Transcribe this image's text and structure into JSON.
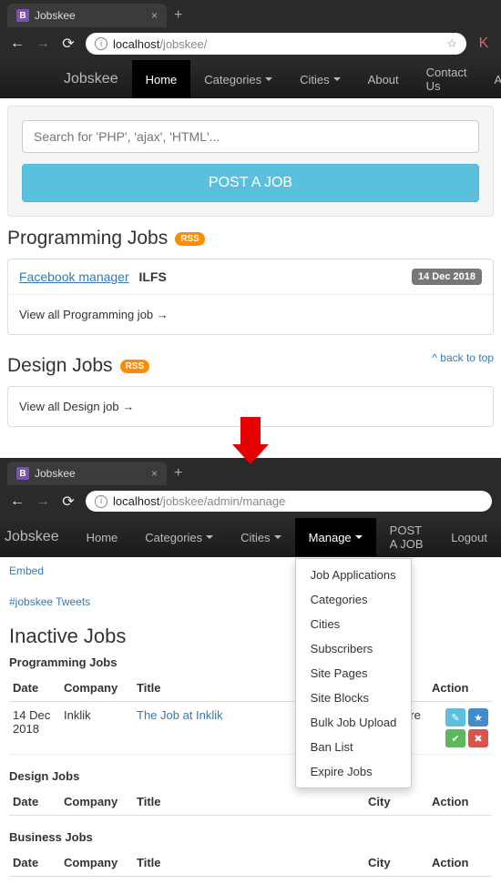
{
  "window1": {
    "tab_title": "Jobskee",
    "url_host": "localhost",
    "url_path": "/jobskee/",
    "brand": "Jobskee",
    "nav": {
      "home": "Home",
      "categories": "Categories",
      "cities": "Cities",
      "about": "About",
      "contact": "Contact Us",
      "admin": "Admin"
    },
    "search_placeholder": "Search for 'PHP', 'ajax', 'HTML'...",
    "post_job": "POST A JOB",
    "sections": {
      "programming": {
        "title": "Programming Jobs",
        "rss": "RSS",
        "job_link": "Facebook manager",
        "company": "ILFS",
        "date": "14 Dec 2018",
        "viewall": "View all Programming job →"
      },
      "design": {
        "title": "Design Jobs",
        "rss": "RSS",
        "viewall": "View all Design job →"
      }
    },
    "back_to_top": "^ back to top"
  },
  "window2": {
    "tab_title": "Jobskee",
    "url_host": "localhost",
    "url_path": "/jobskee/admin/manage",
    "brand": "Jobskee",
    "nav": {
      "home": "Home",
      "categories": "Categories",
      "cities": "Cities",
      "manage": "Manage",
      "post": "POST A JOB",
      "logout": "Logout"
    },
    "manage_menu": [
      "Job Applications",
      "Categories",
      "Cities",
      "Subscribers",
      "Site Pages",
      "Site Blocks",
      "Bulk Job Upload",
      "Ban List",
      "Expire Jobs"
    ],
    "embed": "Embed",
    "tweets": "#jobskee Tweets",
    "h2": "Inactive Jobs",
    "columns": {
      "date": "Date",
      "company": "Company",
      "title": "Title",
      "city": "City",
      "action": "Action"
    },
    "sections": {
      "programming": {
        "heading": "Programming Jobs",
        "rows": [
          {
            "date": "14 Dec 2018",
            "company": "Inklik",
            "title": "The Job at Inklik",
            "city": "Anywhere"
          }
        ]
      },
      "design": {
        "heading": "Design Jobs",
        "rows": []
      },
      "business": {
        "heading": "Business Jobs",
        "rows": []
      }
    }
  }
}
